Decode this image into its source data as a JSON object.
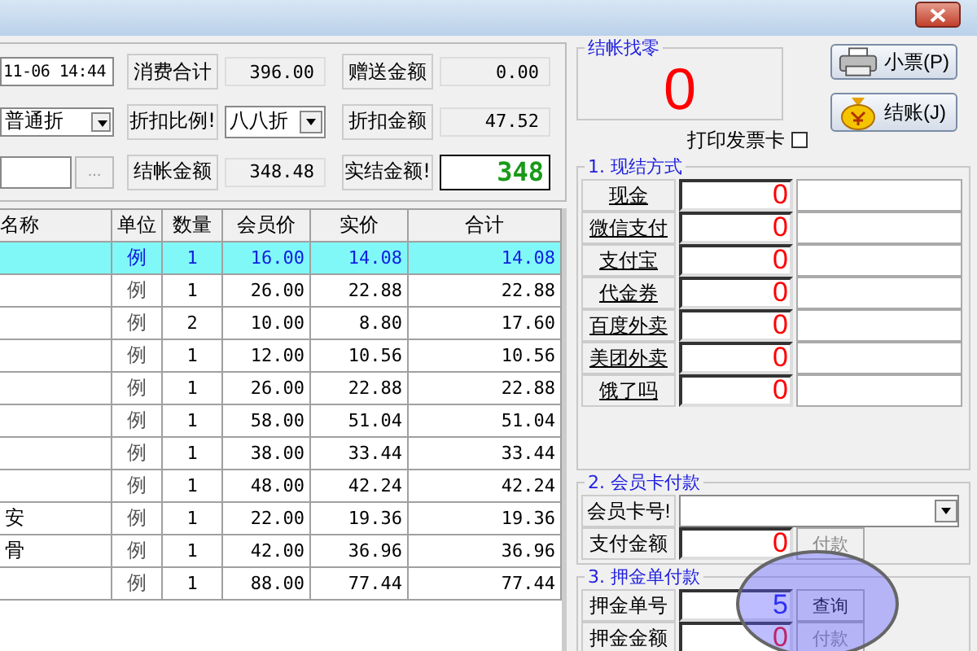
{
  "summary": {
    "rows": [
      {
        "field": {
          "kind": "text",
          "value": "11-06 14:44"
        },
        "label_1": "消费合计",
        "value_1": "396.00",
        "label_2": "赠送金额",
        "value_2": "0.00"
      },
      {
        "field": {
          "kind": "dropdown",
          "value": "普通折"
        },
        "label_1": "折扣比例!",
        "dropdown_1": "八八折",
        "label_2": "折扣金额",
        "value_2": "47.52"
      },
      {
        "field": {
          "kind": "browse",
          "button": "..."
        },
        "label_1": "结帐金额",
        "value_1": "348.48",
        "label_2": "实结金额!",
        "total": "348"
      }
    ]
  },
  "table": {
    "columns": [
      "名称",
      "单位",
      "数量",
      "会员价",
      "实价",
      "合计"
    ],
    "rows": [
      {
        "selected": true,
        "cells": [
          "",
          "例",
          "1",
          "16.00",
          "14.08",
          "14.08"
        ]
      },
      {
        "selected": false,
        "cells": [
          "",
          "例",
          "1",
          "26.00",
          "22.88",
          "22.88"
        ]
      },
      {
        "selected": false,
        "cells": [
          "",
          "例",
          "2",
          "10.00",
          "8.80",
          "17.60"
        ]
      },
      {
        "selected": false,
        "cells": [
          "",
          "例",
          "1",
          "12.00",
          "10.56",
          "10.56"
        ]
      },
      {
        "selected": false,
        "cells": [
          "",
          "例",
          "1",
          "26.00",
          "22.88",
          "22.88"
        ]
      },
      {
        "selected": false,
        "cells": [
          "",
          "例",
          "1",
          "58.00",
          "51.04",
          "51.04"
        ]
      },
      {
        "selected": false,
        "cells": [
          "",
          "例",
          "1",
          "38.00",
          "33.44",
          "33.44"
        ]
      },
      {
        "selected": false,
        "cells": [
          "",
          "例",
          "1",
          "48.00",
          "42.24",
          "42.24"
        ]
      },
      {
        "selected": false,
        "cells": [
          "安",
          "例",
          "1",
          "22.00",
          "19.36",
          "19.36"
        ]
      },
      {
        "selected": false,
        "cells": [
          "骨",
          "例",
          "1",
          "42.00",
          "36.96",
          "36.96"
        ]
      },
      {
        "selected": false,
        "cells": [
          "",
          "例",
          "1",
          "88.00",
          "77.44",
          "77.44"
        ]
      }
    ]
  },
  "change": {
    "title": "结帐找零",
    "value": "0"
  },
  "buttons": [
    {
      "kind": "printer",
      "label": "小票(P)"
    },
    {
      "kind": "coins",
      "label": "结账(J)"
    }
  ],
  "print_invoice": {
    "label": "打印发票卡",
    "checked": false
  },
  "cash_payment": {
    "title": "1. 现结方式",
    "methods": [
      {
        "label": "现金",
        "amount": "0"
      },
      {
        "label": "微信支付",
        "amount": "0"
      },
      {
        "label": "支付宝",
        "amount": "0"
      },
      {
        "label": "代金券",
        "amount": "0"
      },
      {
        "label": "百度外卖",
        "amount": "0"
      },
      {
        "label": "美团外卖",
        "amount": "0"
      },
      {
        "label": "饿了吗",
        "amount": "0"
      }
    ]
  },
  "card_payment": {
    "title": "2. 会员卡付款",
    "card_label": "会员卡号!",
    "amount_label": "支付金额",
    "amount": "0",
    "pay_button": {
      "label": "付款",
      "disabled": true
    }
  },
  "deposit_payment": {
    "title": "3. 押金单付款",
    "number_label": "押金单号",
    "number": "5",
    "query_button": {
      "label": "查询",
      "disabled": false
    },
    "amount_label": "押金金额",
    "amount": "0",
    "pay_button": {
      "label": "付款",
      "disabled": true
    }
  }
}
